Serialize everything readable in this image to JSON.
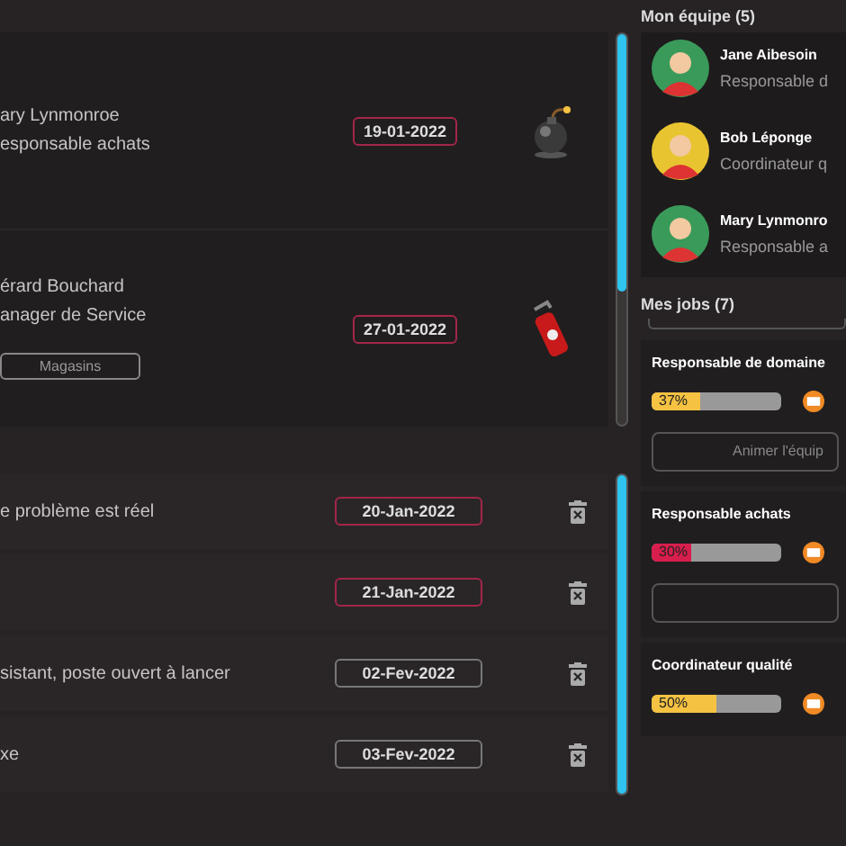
{
  "assignments": [
    {
      "person": "ary Lynmonroe",
      "role": "esponsable achats",
      "date": "19-01-2022",
      "overdue": true,
      "kind": "bomb"
    },
    {
      "person": "érard Bouchard",
      "role": "anager de Service",
      "date": "27-01-2022",
      "overdue": true,
      "kind": "extinguisher",
      "tag": "Magasins"
    }
  ],
  "tasks": [
    {
      "text": "e problème est réel",
      "date": "20-Jan-2022",
      "overdue": true
    },
    {
      "date": "21-Jan-2022",
      "overdue": true
    },
    {
      "text": "sistant, poste ouvert à lancer",
      "date": "02-Fev-2022",
      "overdue": false
    },
    {
      "text": "xe",
      "date": "03-Fev-2022",
      "overdue": false
    }
  ],
  "team": {
    "title": "Mon équipe (5)",
    "members": [
      {
        "name": "Jane Aibesoin",
        "role": "Responsable d",
        "color": "#3a9a5a"
      },
      {
        "name": "Bob Léponge",
        "role": "Coordinateur q",
        "color": "#e8c431"
      },
      {
        "name": "Mary Lynmonro",
        "role": "Responsable a",
        "color": "#3a9a5a"
      }
    ]
  },
  "jobs": {
    "title": "Mes jobs (7)",
    "items": [
      {
        "title": "Responsable de domaine",
        "level": 0.37,
        "percent": "37%",
        "color": "#f5c242",
        "action_box": true,
        "action_label": "Animer l'équip"
      },
      {
        "title": "Responsable achats",
        "level": 0.3,
        "percent": "30%",
        "color": "#d81e4c",
        "action_box": true
      },
      {
        "title": "Coordinateur qualité",
        "level": 0.5,
        "percent": "50%",
        "color": "#f5c242",
        "action_box": false
      }
    ]
  }
}
